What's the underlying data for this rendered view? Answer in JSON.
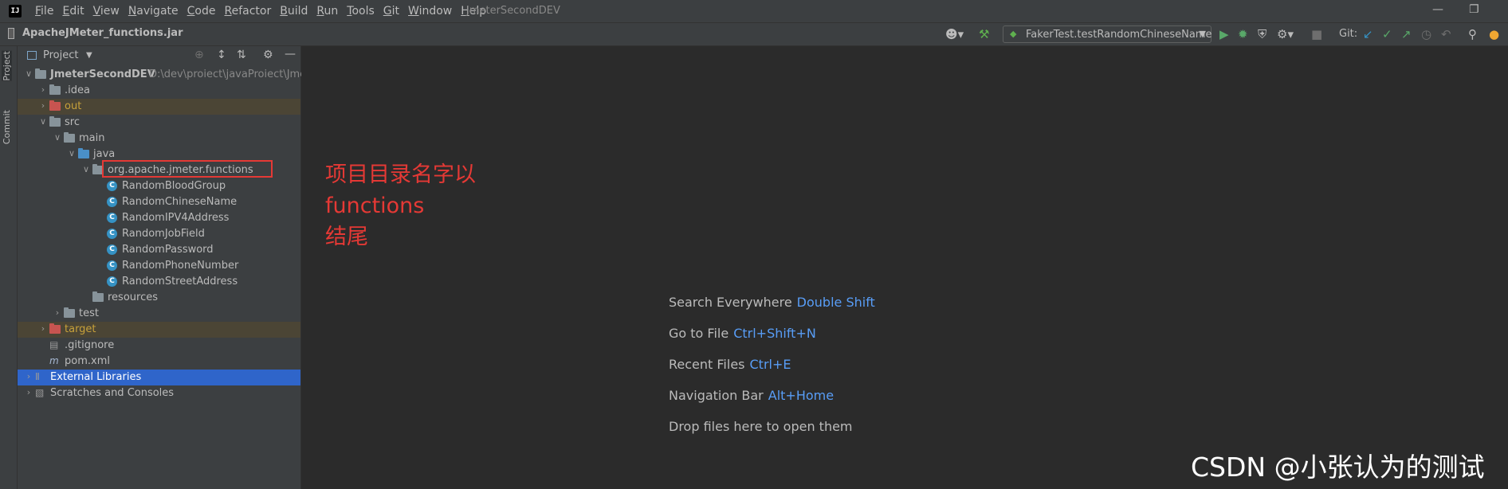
{
  "menubar": {
    "items": [
      "File",
      "Edit",
      "View",
      "Navigate",
      "Code",
      "Refactor",
      "Build",
      "Run",
      "Tools",
      "Git",
      "Window",
      "Help"
    ],
    "window_title": "JmeterSecondDEV",
    "minimize": "—",
    "restore": "❐"
  },
  "navbar": {
    "title": "ApacheJMeter_functions.jar",
    "run_config": "FakerTest.testRandomChineseName",
    "git_label": "Git:"
  },
  "left_strip": {
    "project_tab": "Project",
    "commit_tab": "Commit"
  },
  "project_panel": {
    "title": "Project",
    "tree": [
      {
        "label": "JmeterSecondDEV",
        "path": "D:\\dev\\proiect\\javaProiect\\Jmeter",
        "arrow": "v",
        "icon": "module-folder"
      },
      {
        "label": ".idea",
        "arrow": ">",
        "icon": "folder"
      },
      {
        "label": "out",
        "arrow": ">",
        "icon": "folder-excluded",
        "highlight": true
      },
      {
        "label": "src",
        "arrow": "v",
        "icon": "folder"
      },
      {
        "label": "main",
        "arrow": "v",
        "icon": "folder"
      },
      {
        "label": "java",
        "arrow": "v",
        "icon": "source-folder"
      },
      {
        "label": "org.apache.jmeter.functions",
        "arrow": "v",
        "icon": "package"
      },
      {
        "label": "RandomBloodGroup",
        "icon": "class"
      },
      {
        "label": "RandomChineseName",
        "icon": "class"
      },
      {
        "label": "RandomIPV4Address",
        "icon": "class"
      },
      {
        "label": "RandomJobField",
        "icon": "class"
      },
      {
        "label": "RandomPassword",
        "icon": "class"
      },
      {
        "label": "RandomPhoneNumber",
        "icon": "class"
      },
      {
        "label": "RandomStreetAddress",
        "icon": "class"
      },
      {
        "label": "resources",
        "icon": "resources-folder"
      },
      {
        "label": "test",
        "arrow": ">",
        "icon": "folder"
      },
      {
        "label": "target",
        "arrow": ">",
        "icon": "folder-excluded",
        "highlight": true
      },
      {
        "label": ".gitignore",
        "icon": "gitignore"
      },
      {
        "label": "pom.xml",
        "icon": "maven"
      },
      {
        "label": "External Libraries",
        "arrow": ">",
        "icon": "libraries",
        "selected": true
      },
      {
        "label": "Scratches and Consoles",
        "arrow": ">",
        "icon": "scratches"
      }
    ]
  },
  "annotation": {
    "line1": "项目目录名字以",
    "line2": "functions",
    "line3": "结尾",
    "color": "#e53935"
  },
  "editor_hints": [
    {
      "label": "Search Everywhere",
      "key": "Double Shift"
    },
    {
      "label": "Go to File",
      "key": "Ctrl+Shift+N"
    },
    {
      "label": "Recent Files",
      "key": "Ctrl+E"
    },
    {
      "label": "Navigation Bar",
      "key": "Alt+Home"
    },
    {
      "label": "Drop files here to open them",
      "key": ""
    }
  ],
  "watermark": "CSDN @小张认为的测试",
  "colors": {
    "accent_blue": "#589df6",
    "selection": "#2f65ca",
    "excluded_folder": "#c75450",
    "class_icon": "#3592c4"
  }
}
